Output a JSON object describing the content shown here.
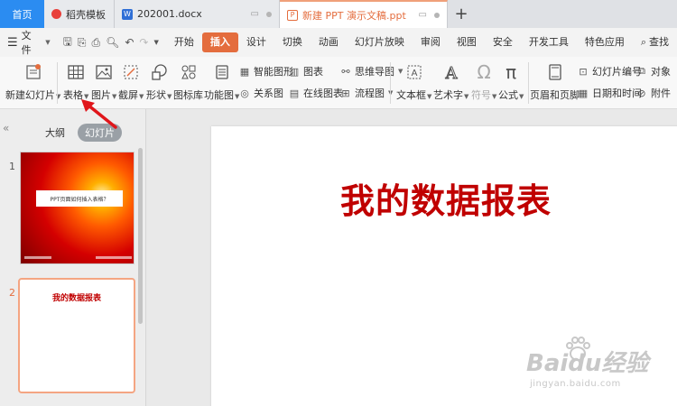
{
  "tabs": [
    {
      "label": "首页"
    },
    {
      "label": "稻壳模板"
    },
    {
      "label": "202001.docx"
    },
    {
      "label": "新建 PPT 演示文稿.ppt"
    }
  ],
  "menu": {
    "file_label": "文件",
    "items": [
      "开始",
      "插入",
      "设计",
      "切换",
      "动画",
      "幻灯片放映",
      "审阅",
      "视图",
      "安全",
      "开发工具",
      "特色应用"
    ],
    "search_label": "查找",
    "active": "插入"
  },
  "ribbon": {
    "new_slide": "新建幻灯片",
    "table": "表格",
    "picture": "图片",
    "screenshot": "截屏",
    "shape": "形状",
    "icon_lib": "图标库",
    "function_chart": "功能图",
    "smart_graphic": "智能图形",
    "chart": "图表",
    "relation_chart": "关系图",
    "online_chart": "在线图表",
    "mind_map": "思维导图",
    "flow_chart": "流程图",
    "textbox": "文本框",
    "art_text": "艺术字",
    "symbol": "符号",
    "formula": "公式",
    "header_footer": "页眉和页脚",
    "slide_number": "幻灯片编号",
    "object": "对象",
    "date_time": "日期和时间",
    "attachment": "附件"
  },
  "panel": {
    "tab_outline": "大纲",
    "tab_slides": "幻灯片",
    "slides": [
      {
        "number": "1",
        "title": "PPT页面如何插入表格？"
      },
      {
        "number": "2",
        "title": "我的数据报表"
      }
    ]
  },
  "slide": {
    "title": "我的数据报表"
  },
  "watermark": {
    "brand": "Baidu经验",
    "url": "jingyan.baidu.com"
  },
  "colors": {
    "accent": "#e46d3e",
    "home_tab": "#2b8cf1",
    "title_red": "#c00000"
  }
}
